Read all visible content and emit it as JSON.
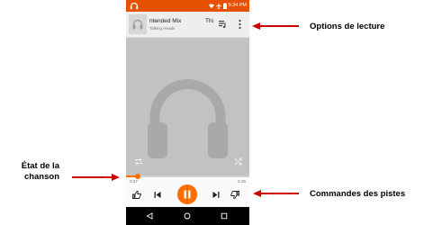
{
  "status_bar": {
    "time": "5:34 PM",
    "icons": [
      "headphones-status-icon",
      "wifi-icon",
      "airplane-icon",
      "battery-icon"
    ]
  },
  "now_playing": {
    "title": "ntended Mix",
    "artist": "Talking Heads",
    "next_title": "Thi",
    "thumbnail_icon": "headphones-icon"
  },
  "playback": {
    "current_time": "0:37",
    "total_time": "6:35",
    "progress_fraction": 0.094
  },
  "controls": {
    "icons": [
      "thumb-up-icon",
      "previous-icon",
      "pause-icon",
      "next-icon",
      "thumb-down-icon"
    ]
  },
  "nav_bar": {
    "icons": [
      "back-icon",
      "home-icon",
      "recents-icon"
    ]
  },
  "annotations": {
    "options": "Options de lecture",
    "etat_line1": "État de la",
    "etat_line2": "chanson",
    "commandes": "Commandes des pistes"
  },
  "colors": {
    "accent": "#ff6d00",
    "status_bar": "#e65100",
    "arrow": "#cc0000"
  }
}
